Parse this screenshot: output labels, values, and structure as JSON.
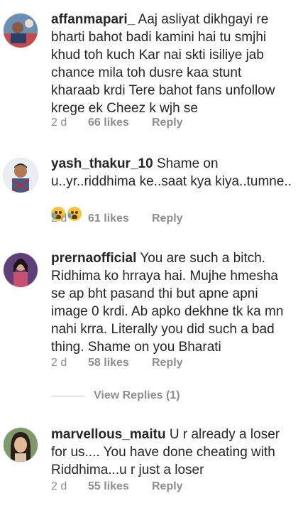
{
  "comments": [
    {
      "username": "affanmapari_",
      "text": "Aaj asliyat dikhgayi re  bharti bahot badi kamini hai tu smjhi khud toh kuch Kar nai skti isiliye jab chance mila toh dusre kaa stunt kharaab krdi Tere bahot fans unfollow krege ek Cheez k wjh se",
      "age": "2 d",
      "likes": "66 likes",
      "reply": "Reply",
      "avatar_icon": "user-avatar-affanmapari"
    },
    {
      "username": "yash_thakur_10",
      "text": "Shame on u..yr..riddhima ke..saat kya kiya..tumne..",
      "emoji_icon": "crying-face-emoji",
      "age": "2 d",
      "likes": "61 likes",
      "reply": "Reply",
      "avatar_icon": "user-avatar-yash"
    },
    {
      "username": "prernaofficial",
      "text": "You are such a bitch. Ridhima ko hrraya hai. Mujhe hmesha se ap bht pasand thi but apne apni image 0 krdi. Ab apko dekhne tk ka mn nahi krra. Literally you did such a bad thing. Shame on you Bharati",
      "age": "2 d",
      "likes": "58 likes",
      "reply": "Reply",
      "avatar_icon": "user-avatar-prerna"
    },
    {
      "username": "marvellous_maitu",
      "text": "U r already a loser for us.... You have done cheating with Riddhima...u r just a loser",
      "age": "2 d",
      "likes": "55 likes",
      "reply": "Reply",
      "avatar_icon": "user-avatar-maitu"
    }
  ],
  "view_replies": "View Replies (1)",
  "colors": {
    "text": "#262626",
    "meta": "#8e8e8e",
    "divider": "#c7c7c7"
  }
}
